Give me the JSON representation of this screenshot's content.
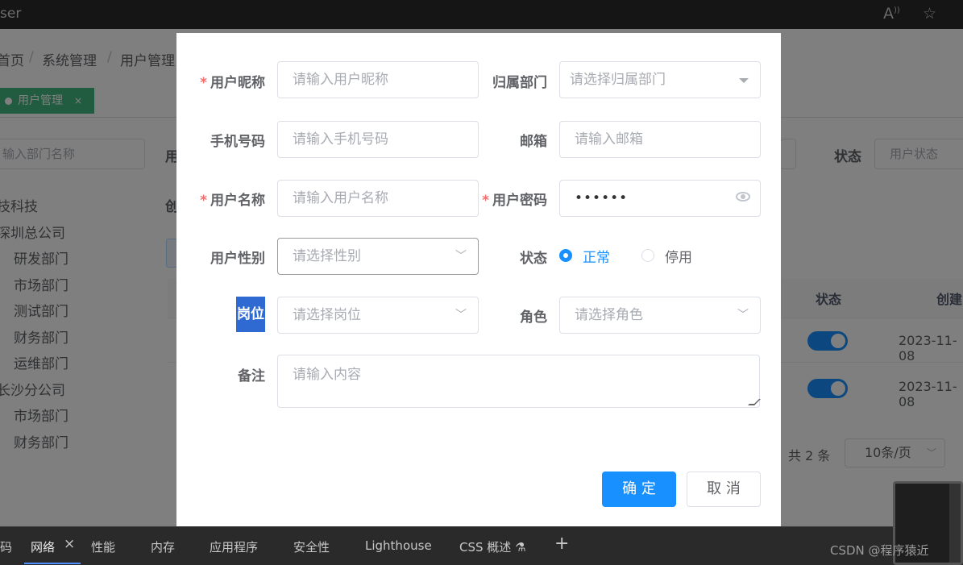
{
  "browser": {
    "url_fragment": "ser",
    "read_aloud_icon": "read-aloud-icon",
    "favorite_icon": "star-icon"
  },
  "background": {
    "breadcrumb": [
      "首页",
      "系统管理",
      "用户管理"
    ],
    "breadcrumb_visible": [
      "首页",
      "系统管理",
      "用户管理"
    ],
    "tag_active": "用户管理",
    "tag_close": "×",
    "dept_search_placeholder": "请输入部门名称",
    "dept_search_visible": "输入部门名称",
    "tree": [
      "依科技",
      "深圳总公司",
      "研发部门",
      "市场部门",
      "测试部门",
      "财务部门",
      "运维部门",
      "长沙分公司",
      "市场部门",
      "财务部门"
    ],
    "tree_visible": [
      "技科技",
      "深圳总公司",
      "研发部门",
      "市场部门",
      "测试部门",
      "财务部门",
      "运维部门",
      "长沙分公司",
      "市场部门",
      "财务部门"
    ],
    "label_fragment_1": "用",
    "label_fragment_2": "创",
    "status_label": "状态",
    "status_placeholder": "用户状态",
    "table_headers": {
      "status": "状态",
      "created": "创建"
    },
    "rows": [
      {
        "date": "2023-11-08"
      },
      {
        "date": "2023-11-08"
      }
    ],
    "pagination": {
      "total": "共 2 条",
      "size": "10条/页"
    }
  },
  "dialog": {
    "nickname": {
      "label": "用户昵称",
      "placeholder": "请输入用户昵称",
      "required": true
    },
    "dept": {
      "label": "归属部门",
      "placeholder": "请选择归属部门"
    },
    "phone": {
      "label": "手机号码",
      "placeholder": "请输入手机号码"
    },
    "email": {
      "label": "邮箱",
      "placeholder": "请输入邮箱"
    },
    "username": {
      "label": "用户名称",
      "placeholder": "请输入用户名称",
      "required": true
    },
    "password": {
      "label": "用户密码",
      "value": "••••••",
      "required": true
    },
    "sex": {
      "label": "用户性别",
      "placeholder": "请选择性别"
    },
    "status": {
      "label": "状态",
      "options": [
        "正常",
        "停用"
      ],
      "selected": "正常"
    },
    "post": {
      "label": "岗位",
      "placeholder": "请选择岗位"
    },
    "role": {
      "label": "角色",
      "placeholder": "请选择角色"
    },
    "remark": {
      "label": "备注",
      "placeholder": "请输入内容"
    },
    "required_mark": "*",
    "confirm": "确 定",
    "cancel": "取 消"
  },
  "devtools": {
    "tabs": [
      "码",
      "网络",
      "性能",
      "内存",
      "应用程序",
      "安全性",
      "Lighthouse",
      "CSS 概述 ",
      "+"
    ],
    "active_tab": "网络",
    "close": "×"
  },
  "watermark": "CSDN @程序猿近"
}
